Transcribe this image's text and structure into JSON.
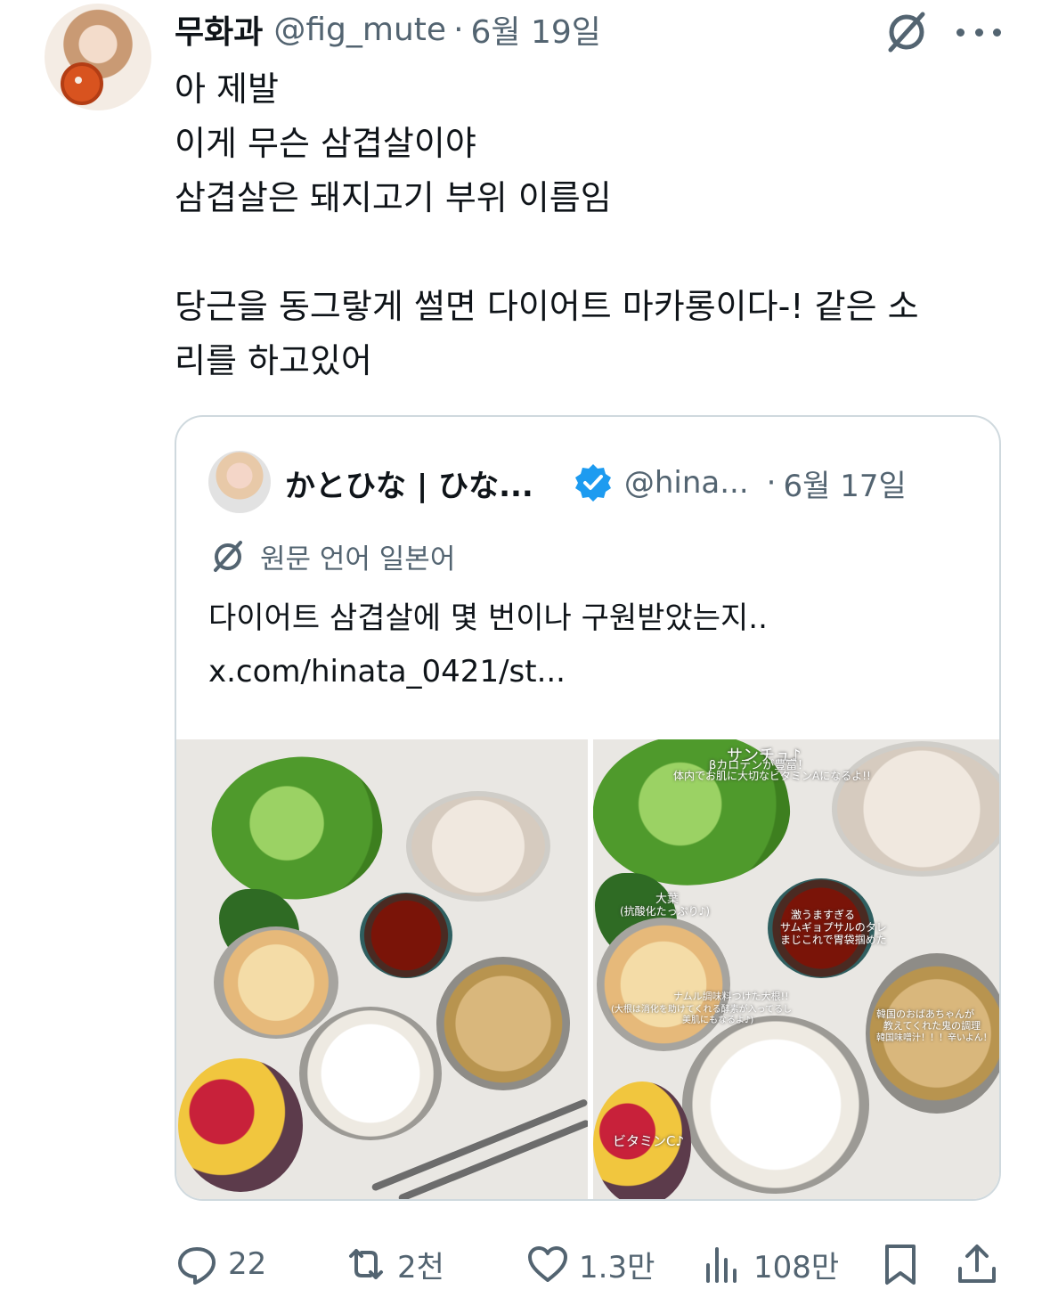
{
  "tweet": {
    "display_name": "무화과",
    "handle": "@fig_mute",
    "separator": "·",
    "date": "6월 19일",
    "lines": [
      "아 제발",
      "이게 무슨 삼겹살이야",
      "삼겹살은 돼지고기 부위 이름임",
      "",
      "당근을 동그랗게 썰면 다이어트 마카롱이다-! 같은 소",
      "리를 하고있어"
    ]
  },
  "quote": {
    "display_name": "かとひな | ひな...",
    "handle": "@hina...",
    "separator": "·",
    "date": "6월 17일",
    "translated_label": "원문 언어 일본어",
    "text_line1": "다이어트 삼겹살에 몇 번이나 구원받았는지..",
    "text_line2": "x.com/hinata_0421/st...",
    "image2_captions": {
      "lettuce": "サンチュ♪",
      "lettuce_sub1": "βカロテンが豊富！",
      "lettuce_sub2": "体内でお肌に大切なビタミンAになるよ!!",
      "perilla": "大葉",
      "perilla_sub": "(抗酸化たっぷり♪)",
      "sauce1": "激うますぎる",
      "sauce2": "サムギョプサルのタレ",
      "sauce3": "まじこれで胃袋掴めた",
      "radish1": "ナムル調味料つけた大根!!",
      "radish2": "(大根は消化を助けてくれる酵素が入ってるし",
      "radish3": "美肌にもなるよ♪)",
      "soup1": "韓国のおばあちゃんが",
      "soup2": "教えてくれた鬼の調理",
      "soup3": "韓国味噌汁！！！辛いよん！",
      "fruit": "ビタミンC♪"
    }
  },
  "actions": {
    "replies": "22",
    "retweets": "2천",
    "likes": "1.3만",
    "views": "108만"
  },
  "colors": {
    "text": "#0f1419",
    "secondary": "#536471",
    "border": "#cfd9de",
    "verified": "#1d9bf0"
  }
}
